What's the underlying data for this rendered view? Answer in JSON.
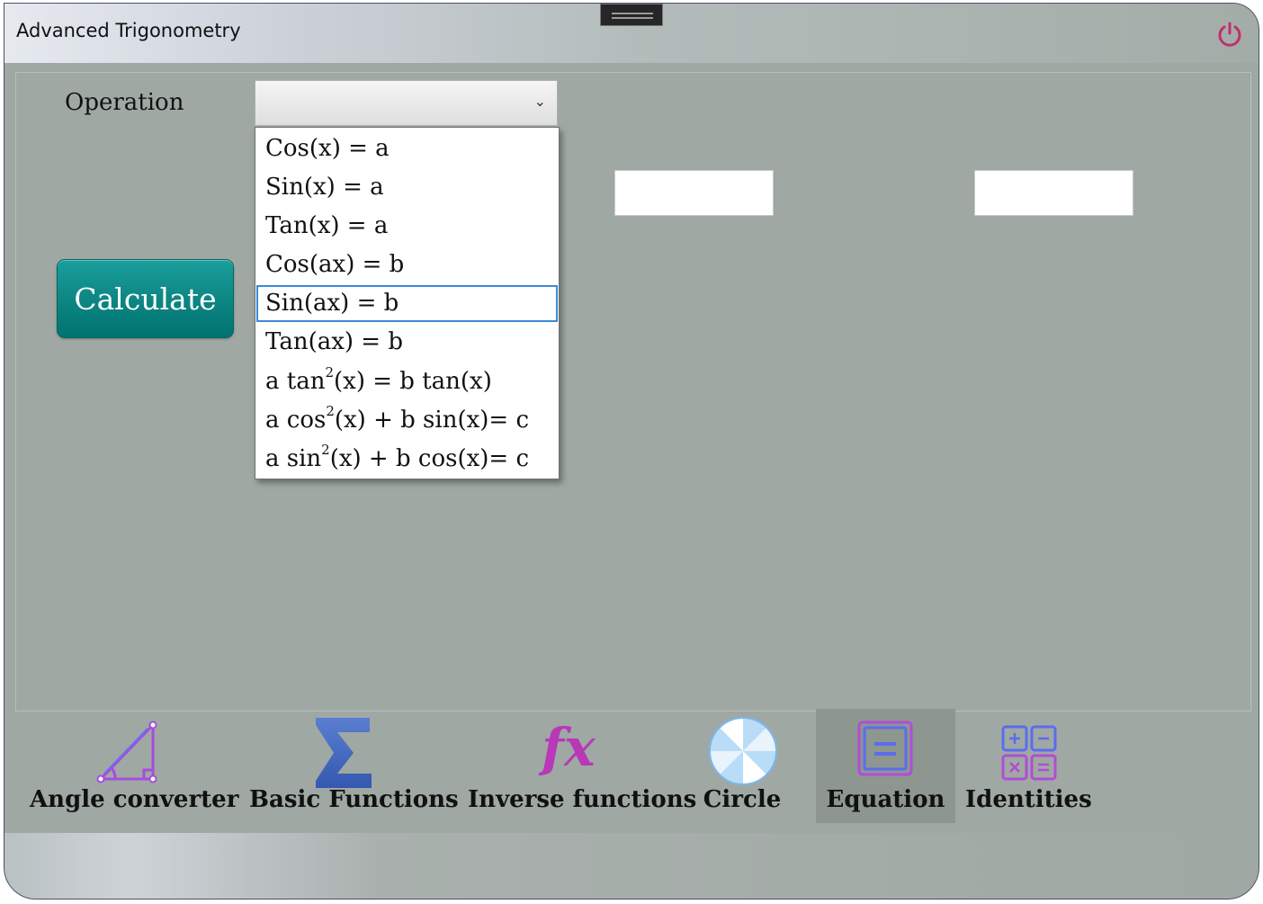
{
  "window": {
    "title": "Advanced Trigonometry"
  },
  "titlebar": {
    "power_icon": "power-icon",
    "grip_icon": "grip-handle-icon"
  },
  "form": {
    "operation_label": "Operation",
    "operation_value": "",
    "input_a_value": "",
    "input_b_value": "",
    "calculate_label": "Calculate"
  },
  "dropdown": {
    "items": [
      {
        "pre": "Cos(x) = a",
        "sup": "",
        "post": ""
      },
      {
        "pre": "Sin(x) = a",
        "sup": "",
        "post": ""
      },
      {
        "pre": "Tan(x) = a",
        "sup": "",
        "post": ""
      },
      {
        "pre": "Cos(ax) = b",
        "sup": "",
        "post": ""
      },
      {
        "pre": "Sin(ax) = b",
        "sup": "",
        "post": ""
      },
      {
        "pre": "Tan(ax) = b",
        "sup": "",
        "post": ""
      },
      {
        "pre": "a tan",
        "sup": "2",
        "post": "(x) = b tan(x)"
      },
      {
        "pre": "a cos",
        "sup": "2",
        "post": "(x) + b sin(x)= c"
      },
      {
        "pre": "a sin",
        "sup": "2",
        "post": "(x) + b cos(x)= c"
      }
    ],
    "highlighted_index": 4
  },
  "nav": {
    "items": [
      {
        "label": "Angle converter",
        "icon": "angle-triangle-icon"
      },
      {
        "label": "Basic Functions",
        "icon": "sigma-icon"
      },
      {
        "label": "Inverse functions",
        "icon": "fx-icon",
        "glyph": "fx"
      },
      {
        "label": "Circle",
        "icon": "circle-icon"
      },
      {
        "label": "Equation",
        "icon": "equation-icon"
      },
      {
        "label": "Identities",
        "icon": "calculator-icon"
      }
    ],
    "active": "Equation"
  },
  "colors": {
    "background": "#9fa8a3",
    "calculate_button": "#0d8784",
    "power_icon": "#c0306e",
    "nav_active": "#8d968f"
  }
}
